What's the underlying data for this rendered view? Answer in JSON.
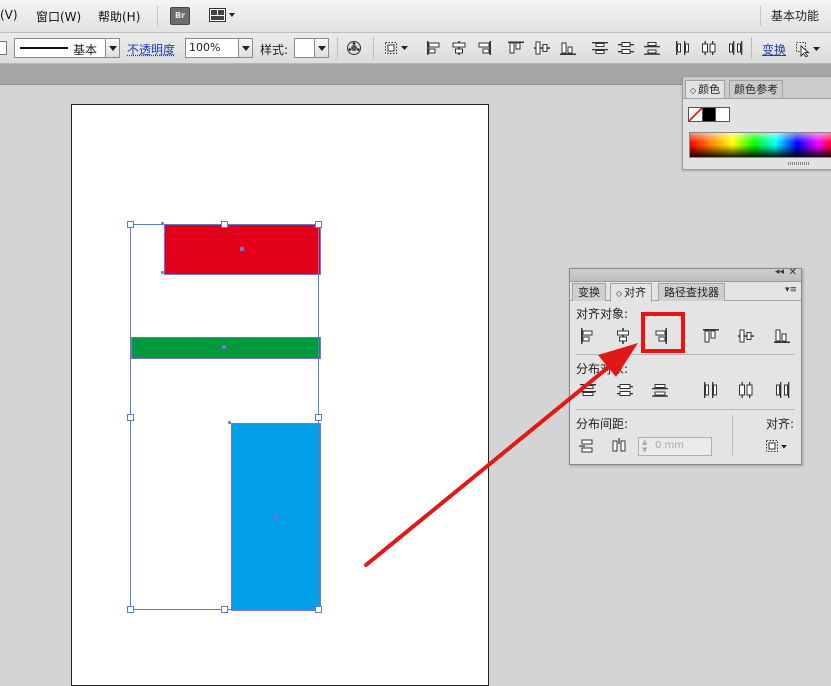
{
  "menubar": {
    "items": [
      "(V)",
      "窗口(W)",
      "帮助(H)"
    ],
    "bridge_badge": "Br",
    "workspace": "基本功能"
  },
  "toolbar": {
    "stroke_style_label": "基本",
    "opacity_label": "不透明度",
    "opacity_value": "100%",
    "style_label": "样式:",
    "transform_link": "变换"
  },
  "color_panel": {
    "tabs": [
      "颜色",
      "颜色参考"
    ]
  },
  "align_panel": {
    "tabs": [
      "变换",
      "对齐",
      "路径查找器"
    ],
    "align_objects_label": "对齐对象:",
    "distribute_objects_label": "分布对象:",
    "distribute_spacing_label": "分布间距:",
    "spacing_value": "0 mm",
    "align_to_label": "对齐:"
  },
  "colors": {
    "red_rect": "#e2001a",
    "green_rect": "#009a3e",
    "blue_rect": "#009fe8",
    "highlight": "#ee1111",
    "arrow": "#e21818"
  }
}
